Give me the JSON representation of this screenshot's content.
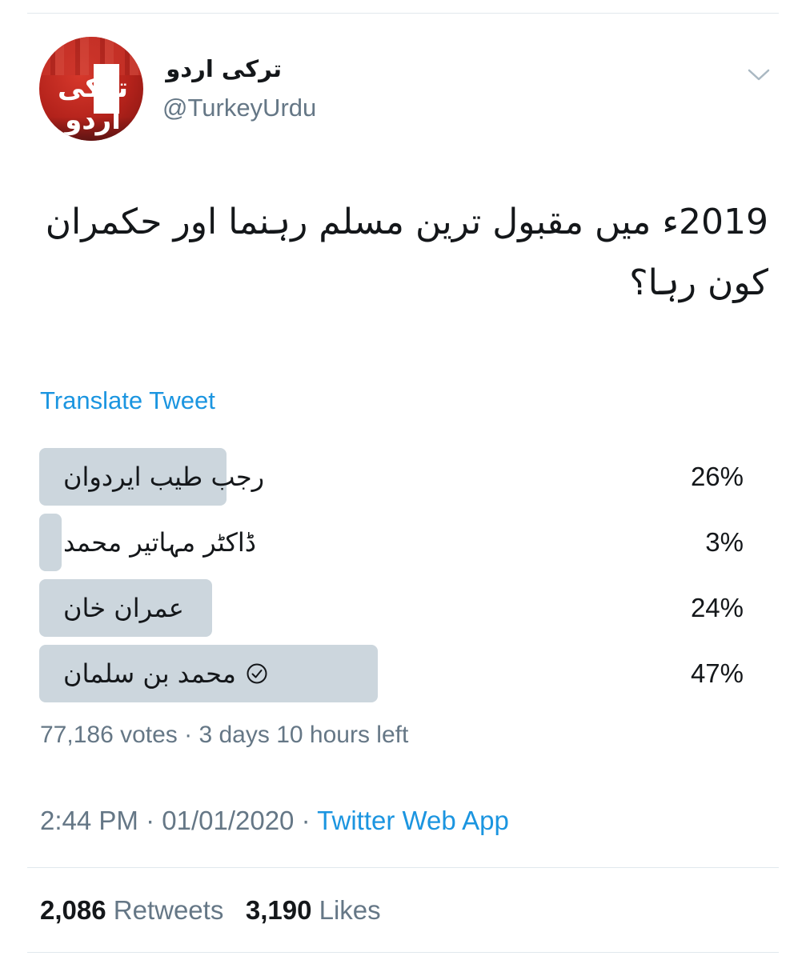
{
  "author": {
    "display_name": "ترکی اردو",
    "handle": "@TurkeyUrdu",
    "avatar_text": "ترکی اردو"
  },
  "tweet": {
    "text": "2019ء میں مقبول ترین مسلم رہنما اور حکمران کون رہا؟",
    "translate_label": "Translate Tweet"
  },
  "poll": {
    "options": [
      {
        "label": "رجب طیب ایردوان",
        "percent_text": "26%",
        "fraction": 0.26,
        "selected": false
      },
      {
        "label": "ڈاکٹر مہاتیر محمد",
        "percent_text": "3%",
        "fraction": 0.03,
        "selected": false
      },
      {
        "label": "عمران خان",
        "percent_text": "24%",
        "fraction": 0.24,
        "selected": false
      },
      {
        "label": "محمد بن سلمان",
        "percent_text": "47%",
        "fraction": 0.47,
        "selected": true
      }
    ],
    "votes_text": "77,186 votes",
    "time_left_text": "3 days 10 hours left"
  },
  "meta": {
    "time": "2:44 PM",
    "date": "01/01/2020",
    "source": "Twitter Web App"
  },
  "stats": {
    "retweets_count": "2,086",
    "retweets_label": "Retweets",
    "likes_count": "3,190",
    "likes_label": "Likes"
  },
  "colors": {
    "link": "#1b95e0",
    "muted": "#657786",
    "poll_bar": "#ccd6dd",
    "avatar_red": "#b3221b"
  }
}
